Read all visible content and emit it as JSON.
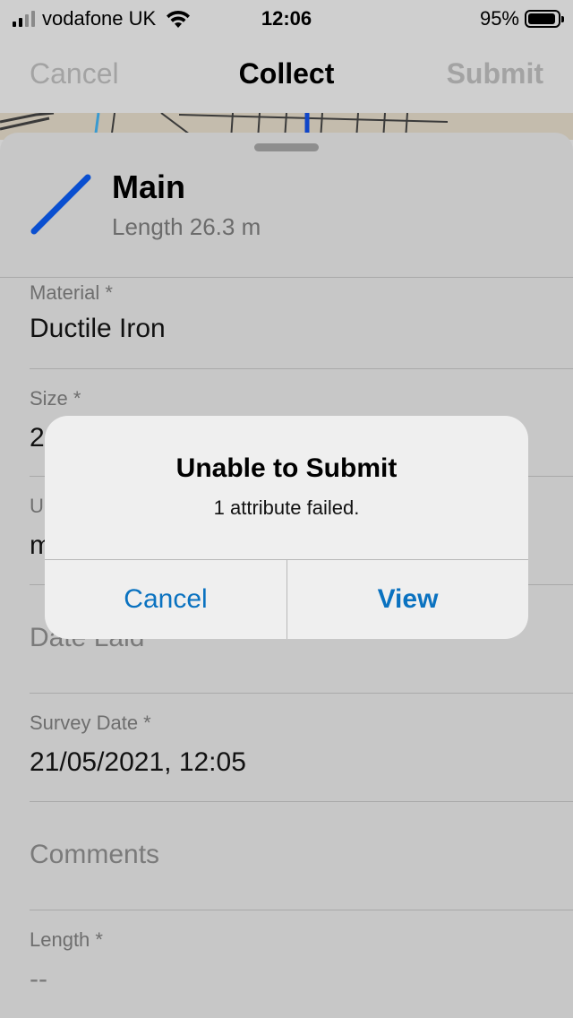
{
  "status_bar": {
    "carrier": "vodafone UK",
    "time": "12:06",
    "battery_percent_label": "95%",
    "battery_level": 0.95
  },
  "nav": {
    "cancel_label": "Cancel",
    "title": "Collect",
    "submit_label": "Submit"
  },
  "feature": {
    "name": "Main",
    "length": "Length 26.3 m",
    "line_color": "#0a4fd0"
  },
  "fields": {
    "material": {
      "label": "Material *",
      "value": "Ductile Iron"
    },
    "size": {
      "label": "Size *",
      "value": "2"
    },
    "third": {
      "label": "U",
      "value": "m"
    },
    "date_laid": {
      "placeholder": "Date Laid"
    },
    "survey_date": {
      "label": "Survey Date *",
      "value": "21/05/2021, 12:05"
    },
    "comments": {
      "placeholder": "Comments"
    },
    "length": {
      "label": "Length *",
      "value": "--"
    }
  },
  "alert": {
    "title": "Unable to Submit",
    "message": "1 attribute failed.",
    "cancel_label": "Cancel",
    "view_label": "View",
    "accent_color": "#0a72c0"
  }
}
